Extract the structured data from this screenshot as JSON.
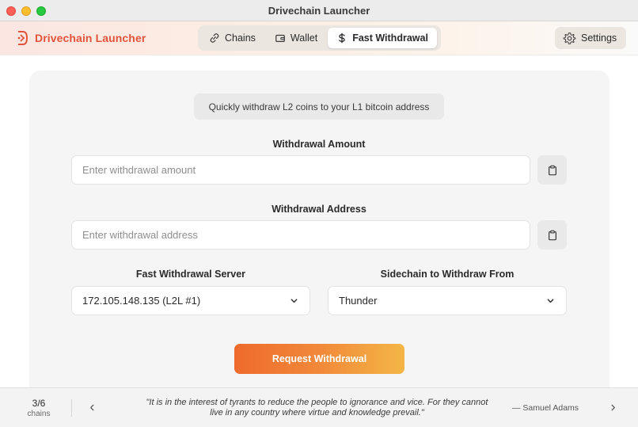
{
  "window": {
    "title": "Drivechain Launcher"
  },
  "brand": {
    "name": "Drivechain Launcher",
    "color": "#e2533b"
  },
  "tabs": [
    {
      "label": "Chains",
      "icon": "link-icon",
      "active": false
    },
    {
      "label": "Wallet",
      "icon": "wallet-icon",
      "active": false
    },
    {
      "label": "Fast Withdrawal",
      "icon": "dollar-icon",
      "active": true
    }
  ],
  "settings": {
    "label": "Settings",
    "icon": "gear-icon"
  },
  "form": {
    "subtitle": "Quickly withdraw L2 coins to your L1 bitcoin address",
    "amount": {
      "label": "Withdrawal Amount",
      "placeholder": "Enter withdrawal amount",
      "value": ""
    },
    "address": {
      "label": "Withdrawal Address",
      "placeholder": "Enter withdrawal address",
      "value": ""
    },
    "server": {
      "label": "Fast Withdrawal Server",
      "selected": "172.105.148.135 (L2L #1)"
    },
    "sidechain": {
      "label": "Sidechain to Withdraw From",
      "selected": "Thunder"
    },
    "submit_label": "Request Withdrawal"
  },
  "footer": {
    "count": "3/6",
    "count_label": "chains",
    "quote": "\"It is in the interest of tyrants to reduce the people to ignorance and vice. For they cannot live in any country where virtue and knowledge prevail.\"",
    "author": "— Samuel Adams"
  },
  "colors": {
    "accent_start": "#ee6a2c",
    "accent_end": "#f4b646",
    "brand": "#e2533b"
  }
}
